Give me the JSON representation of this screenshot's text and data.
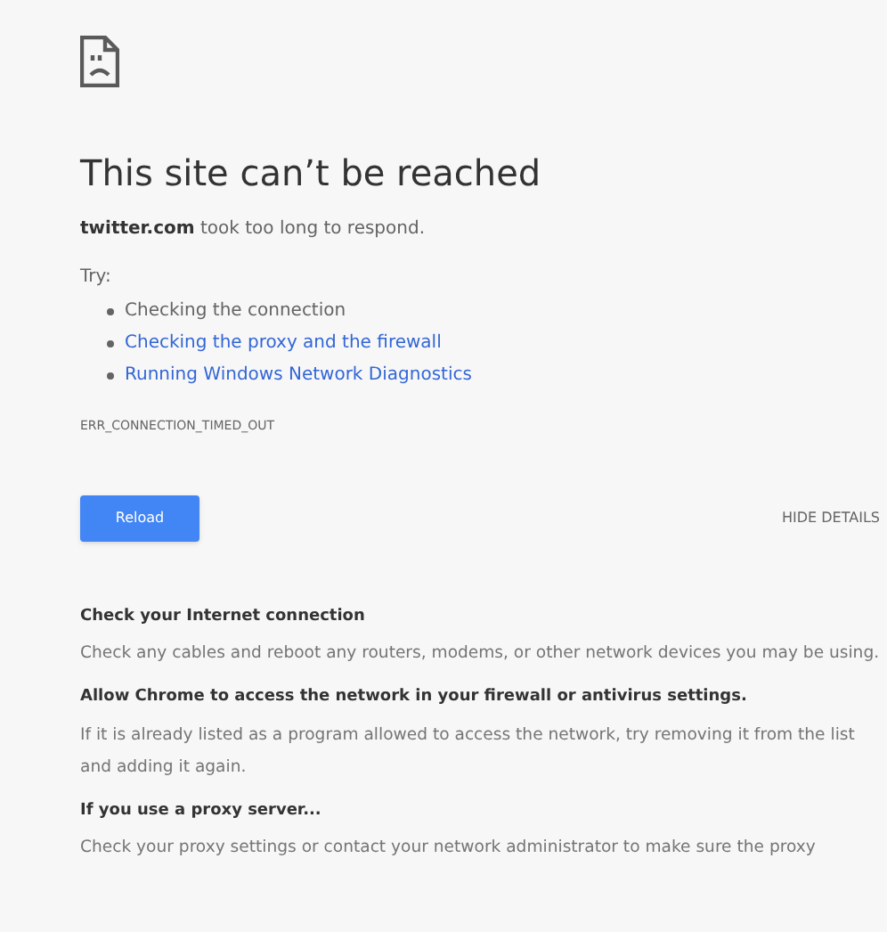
{
  "title": "This site can’t be reached",
  "message": "**twitter.com** took too long to respond.",
  "try_label": "Try:",
  "suggestions": [
    {
      "text": "Checking the connection",
      "kind": "text"
    },
    {
      "text": "Checking the proxy and the firewall",
      "kind": "link"
    },
    {
      "text": "Running Windows Network Diagnostics",
      "kind": "link"
    }
  ],
  "error_code": "ERR_CONNECTION_TIMED_OUT",
  "reload_button": "Reload",
  "details_button": "HIDE DETAILS",
  "details": [
    {
      "heading": "Check your Internet connection",
      "text": "Check any cables and reboot any routers, modems, or other network devices you may be using."
    },
    {
      "heading": "Allow Chrome to access the network in your firewall or antivirus settings.",
      "text": "If it is already listed as a program allowed to access the network, try removing it from the list and adding it again."
    },
    {
      "heading": "If you use a proxy server...",
      "text": "Check your proxy settings or contact your network administrator to make sure the proxy"
    }
  ]
}
